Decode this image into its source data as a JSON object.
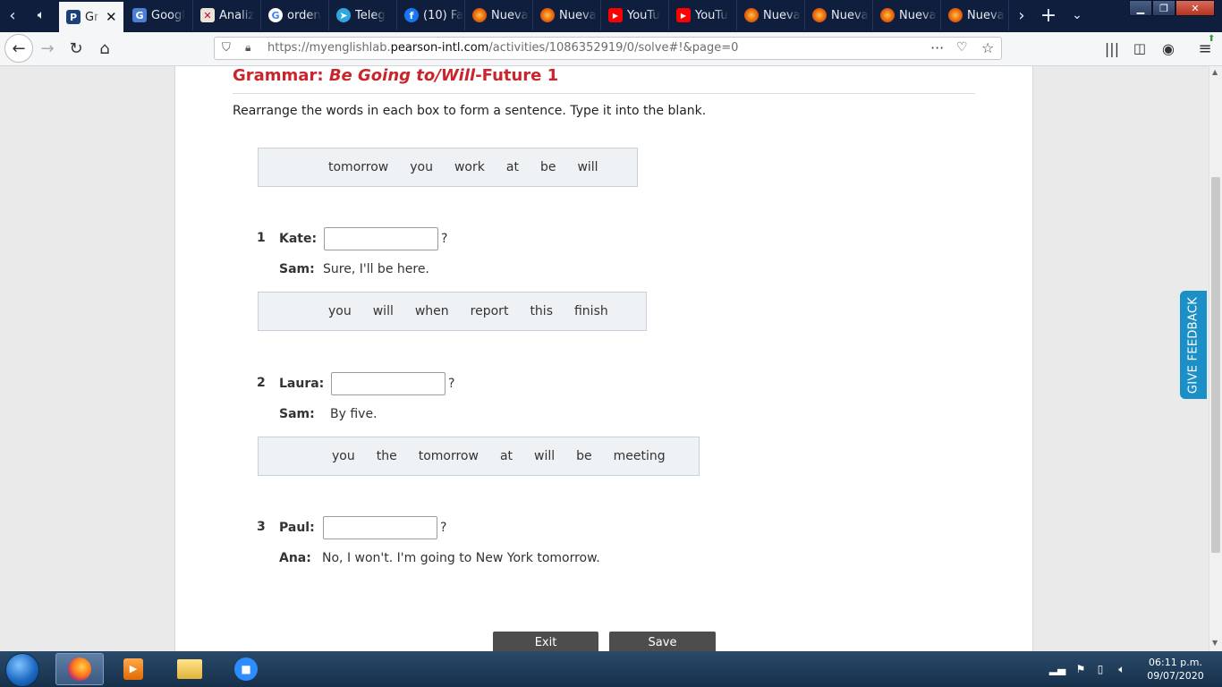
{
  "browser": {
    "tabs": [
      {
        "label": "Gr",
        "icon": "pearson-icon",
        "active": true
      },
      {
        "label": "Googl",
        "icon": "google-translate-icon"
      },
      {
        "label": "Analiz",
        "icon": "analytics-icon"
      },
      {
        "label": "orden",
        "icon": "google-icon"
      },
      {
        "label": "Teleg",
        "icon": "telegram-icon"
      },
      {
        "label": "(10) Fa",
        "icon": "facebook-icon"
      },
      {
        "label": "Nueva",
        "icon": "firefox-icon"
      },
      {
        "label": "Nueva",
        "icon": "firefox-icon"
      },
      {
        "label": "YouTu",
        "icon": "youtube-icon"
      },
      {
        "label": "YouTu",
        "icon": "youtube-icon"
      },
      {
        "label": "Nueva",
        "icon": "firefox-icon"
      },
      {
        "label": "Nueva",
        "icon": "firefox-icon"
      },
      {
        "label": "Nueva",
        "icon": "firefox-icon"
      },
      {
        "label": "Nueva",
        "icon": "firefox-icon"
      }
    ],
    "url_prefix": "https://myenglishlab.",
    "url_domain": "pearson-intl.com",
    "url_path": "/activities/1086352919/0/solve#!&page=0"
  },
  "exercise": {
    "title_prefix": "Grammar: ",
    "title_italic": "Be Going to/Will",
    "title_suffix": "-Future 1",
    "instruction": "Rearrange the words in each box to form a sentence. Type it into the blank.",
    "items": [
      {
        "words": [
          "tomorrow",
          "you",
          "work",
          "at",
          "be",
          "will"
        ],
        "number": "1",
        "speaker": "Kate:",
        "answer": "",
        "question_mark": "?",
        "reply_speaker": "Sam:",
        "reply": "Sure, I'll be here."
      },
      {
        "words": [
          "you",
          "will",
          "when",
          "report",
          "this",
          "finish"
        ],
        "number": "2",
        "speaker": "Laura:",
        "answer": "",
        "question_mark": "?",
        "reply_speaker": "Sam:",
        "reply": "By five."
      },
      {
        "words": [
          "you",
          "the",
          "tomorrow",
          "at",
          "will",
          "be",
          "meeting"
        ],
        "number": "3",
        "speaker": "Paul:",
        "answer": "",
        "question_mark": "?",
        "reply_speaker": "Ana:",
        "reply": "No, I won't. I'm going to New York tomorrow."
      }
    ],
    "buttons": {
      "exit": "Exit",
      "save": "Save"
    }
  },
  "feedback_tab": "GIVE FEEDBACK",
  "taskbar": {
    "time": "06:11 p.m.",
    "date": "09/07/2020"
  },
  "colors": {
    "title_red": "#c8262c",
    "feedback_blue": "#1d8fc7",
    "tab_strip": "#0f1e3c"
  }
}
